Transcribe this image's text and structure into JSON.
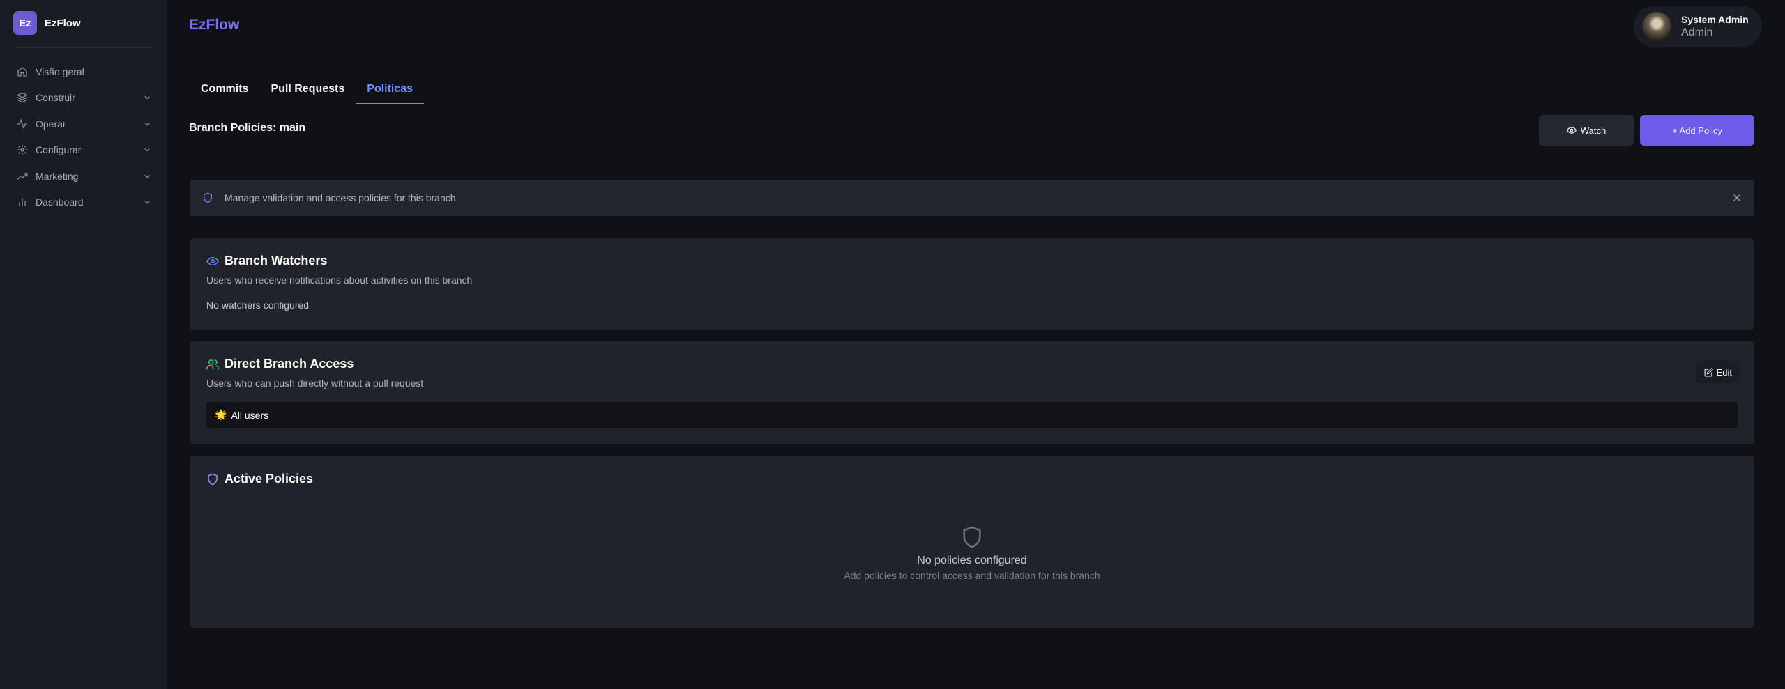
{
  "brand": {
    "logo_text": "Ez",
    "name": "EzFlow"
  },
  "sidebar": {
    "items": [
      {
        "label": "Visão geral",
        "icon": "home-icon"
      },
      {
        "label": "Construir",
        "icon": "layers-icon"
      },
      {
        "label": "Operar",
        "icon": "activity-icon"
      },
      {
        "label": "Configurar",
        "icon": "gear-icon"
      },
      {
        "label": "Marketing",
        "icon": "trending-up-icon"
      },
      {
        "label": "Dashboard",
        "icon": "bar-chart-icon"
      }
    ]
  },
  "header": {
    "title": "EzFlow"
  },
  "user": {
    "name": "System Admin",
    "role": "Admin"
  },
  "tabs": [
    {
      "label": "Commits"
    },
    {
      "label": "Pull Requests"
    },
    {
      "label": "Politicas",
      "active": true
    }
  ],
  "page": {
    "heading": "Branch Policies: main",
    "watch_label": "Watch",
    "add_policy_label": "+ Add Policy"
  },
  "alert": {
    "text": "Manage validation and access policies for this branch."
  },
  "watchers": {
    "title": "Branch Watchers",
    "subtitle": "Users who receive notifications about activities on this branch",
    "empty_text": "No watchers configured"
  },
  "access": {
    "title": "Direct Branch Access",
    "subtitle": "Users who can push directly without a pull request",
    "edit_label": "Edit",
    "entry_emoji": "🌟",
    "entry_label": "All users"
  },
  "policies": {
    "title": "Active Policies",
    "empty_title": "No policies configured",
    "empty_sub": "Add policies to control access and validation for this branch"
  },
  "colors": {
    "accent": "#6c5ce7",
    "tab_active": "#6c8ef5",
    "watchers_icon": "#5b8def",
    "access_icon": "#34c97a",
    "policies_icon": "#a78bfa"
  }
}
